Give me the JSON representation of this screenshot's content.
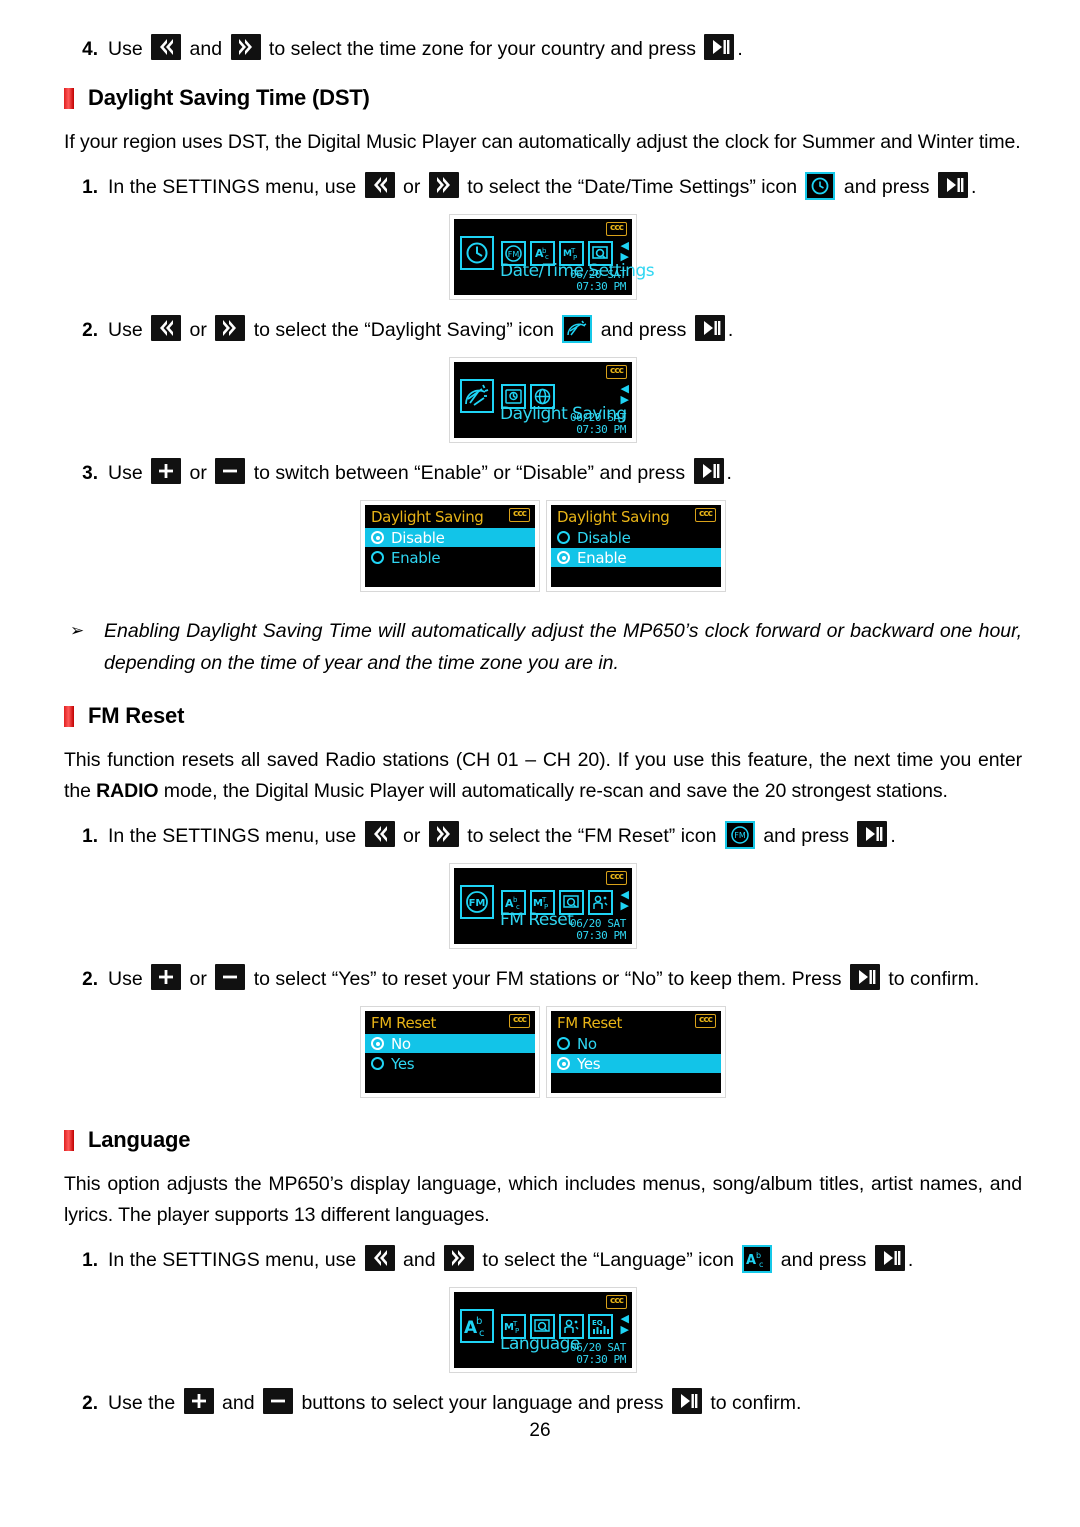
{
  "page": {
    "number": "26"
  },
  "step_top": {
    "num": "4.",
    "t1": "Use",
    "t2": "and",
    "t3": "to select the time zone for your country and press",
    "t4": "."
  },
  "dst": {
    "heading": "Daylight Saving Time (DST)",
    "intro": "If your region uses DST, the Digital Music Player can automatically adjust the clock for Summer and Winter time.",
    "step1": {
      "num": "1.",
      "t1": "In the SETTINGS menu, use",
      "t2": "or",
      "t3": "to select the “Date/Time Settings” icon",
      "t4": "and press",
      "t5": "."
    },
    "step2": {
      "num": "2.",
      "t1": "Use",
      "t2": "or",
      "t3": "to select the “Daylight Saving” icon",
      "t4": "and press",
      "t5": "."
    },
    "step3": {
      "num": "3.",
      "t1": "Use",
      "t2": "or",
      "t3": "to switch between “Enable” or “Disable” and press",
      "t4": "."
    },
    "note": {
      "arrow": "➢",
      "text": "Enabling Daylight Saving Time will automatically adjust the MP650’s clock forward or backward one hour, depending on the time of year and the time zone you are in."
    },
    "screen_datetime": {
      "label": "Date/Time Settings",
      "date": "06/20 SAT",
      "time": "07:30 PM",
      "badge": "ccc",
      "icons": [
        "clock-icon",
        "fm-icon",
        "abc-icon",
        "mtp-icon",
        "magnifier-icon"
      ]
    },
    "screen_daylight": {
      "label": "Daylight Saving",
      "date": "06/20 SAT",
      "time": "07:30 PM",
      "badge": "ccc",
      "icons": [
        "daylight-saving-icon",
        "date-time-icon",
        "timezone-icon"
      ]
    },
    "list_disable": {
      "title": "Daylight Saving",
      "badge": "ccc",
      "options": [
        {
          "label": "Disable",
          "checked": true,
          "highlighted": true
        },
        {
          "label": "Enable",
          "checked": false,
          "highlighted": false
        }
      ]
    },
    "list_enable": {
      "title": "Daylight Saving",
      "badge": "ccc",
      "options": [
        {
          "label": "Disable",
          "checked": false,
          "highlighted": false
        },
        {
          "label": "Enable",
          "checked": true,
          "highlighted": true
        }
      ]
    }
  },
  "fmreset": {
    "heading": "FM Reset",
    "intro_a": "This function resets all saved Radio stations (CH 01 – CH 20). If you use this feature, the next time you enter the ",
    "intro_bold": "RADIO",
    "intro_b": " mode, the Digital Music Player will automatically re-scan and save the 20 strongest stations.",
    "step1": {
      "num": "1.",
      "t1": "In the SETTINGS menu, use",
      "t2": "or",
      "t3": "to select the “FM Reset” icon",
      "t4": "and press",
      "t5": "."
    },
    "step2": {
      "num": "2.",
      "t1": "Use",
      "t2": "or",
      "t3": "to select “Yes” to reset your FM stations or “No” to keep them. Press",
      "t4": "to confirm."
    },
    "screen_menu": {
      "label": "FM Reset",
      "date": "06/20 SAT",
      "time": "07:30 PM",
      "badge": "ccc",
      "icons": [
        "fm-icon",
        "abc-icon",
        "mtp-icon",
        "magnifier-icon",
        "user-icon"
      ]
    },
    "list_no": {
      "title": "FM Reset",
      "badge": "ccc",
      "options": [
        {
          "label": "No",
          "checked": true,
          "highlighted": true
        },
        {
          "label": "Yes",
          "checked": false,
          "highlighted": false
        }
      ]
    },
    "list_yes": {
      "title": "FM Reset",
      "badge": "ccc",
      "options": [
        {
          "label": "No",
          "checked": false,
          "highlighted": false
        },
        {
          "label": "Yes",
          "checked": true,
          "highlighted": true
        }
      ]
    }
  },
  "language": {
    "heading": "Language",
    "intro": "This option adjusts the MP650’s display language, which includes menus, song/album titles, artist names, and lyrics. The player supports 13 different languages.",
    "step1": {
      "num": "1.",
      "t1": "In the SETTINGS menu, use",
      "t2": "and",
      "t3": "to select the “Language” icon",
      "t4": "and press",
      "t5": "."
    },
    "step2": {
      "num": "2.",
      "t1": "Use the",
      "t2": "and",
      "t3": "buttons to select your language and press",
      "t4": "to confirm."
    },
    "screen_menu": {
      "label": "Language",
      "date": "06/20 SAT",
      "time": "07:30 PM",
      "badge": "ccc",
      "icons": [
        "abc-icon",
        "mtp-icon",
        "magnifier-icon",
        "user-icon",
        "eq-icon"
      ]
    }
  },
  "icons": {
    "prev": "rewind-icon",
    "next": "fast-forward-icon",
    "play_pause": "play-pause-icon",
    "plus": "plus-icon",
    "minus": "minus-icon"
  }
}
